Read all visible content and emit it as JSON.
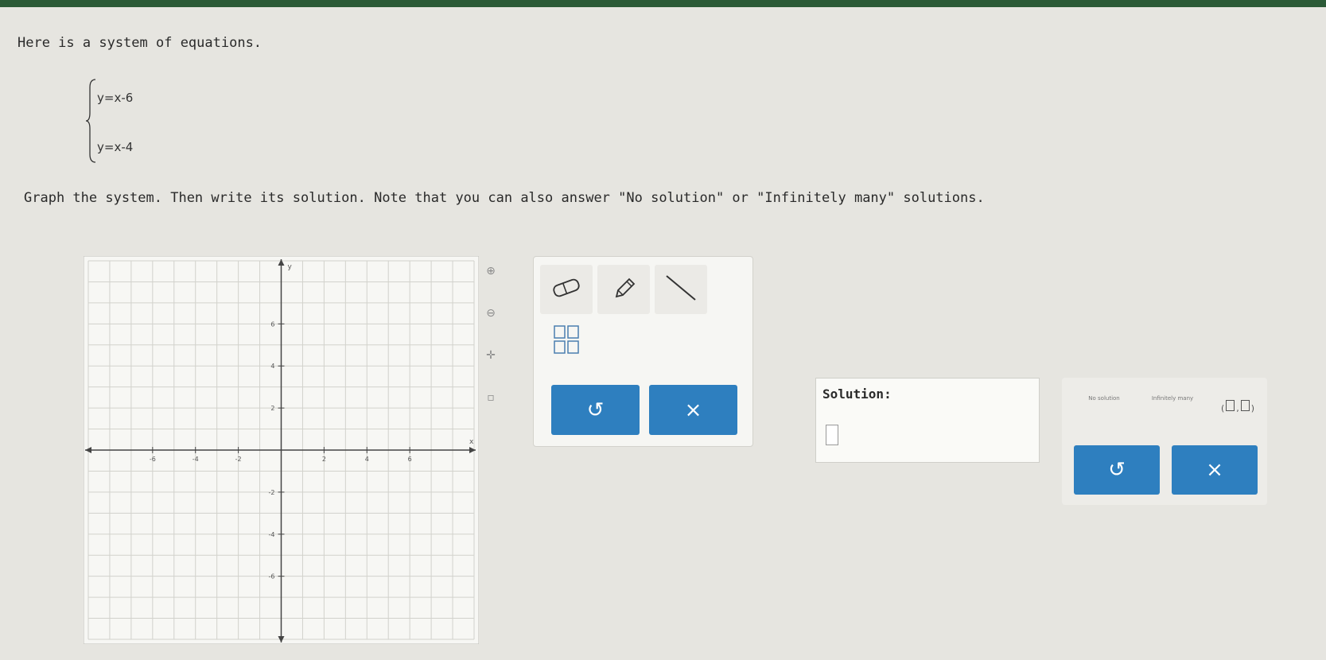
{
  "prompt": "Here is a system of equations.",
  "equations": [
    "y=x-6",
    "y=x-4"
  ],
  "instruction": "Graph the system. Then write its solution. Note that you can also answer \"No solution\" or \"Infinitely many\" solutions.",
  "graph": {
    "x_tick_labels": [
      "-6",
      "-4",
      "-2",
      "2",
      "4",
      "6"
    ],
    "y_tick_labels": [
      "6",
      "4",
      "2",
      "-2",
      "-4",
      "-6"
    ],
    "x_axis_label": "x",
    "y_axis_label": "y"
  },
  "toolbox": {
    "eraser_icon": "eraser-icon",
    "pencil_icon": "pencil-icon",
    "line_icon": "line-segment-icon",
    "fraction_icon": "fraction-icon",
    "undo_label": "↺",
    "clear_label": "×"
  },
  "solution": {
    "label": "Solution:",
    "value": ""
  },
  "answer_panel": {
    "no_solution_label": "No solution",
    "infinitely_many_label": "Infinitely many",
    "ordered_pair_label": "(□,□)",
    "undo_label": "↺",
    "clear_label": "×"
  },
  "colors": {
    "accent": "#2e7fbf",
    "top_bar": "#2b5a36",
    "background": "#e6e5e0"
  }
}
